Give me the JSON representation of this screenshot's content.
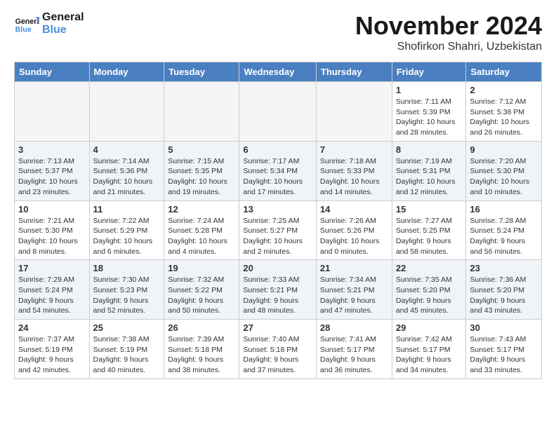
{
  "header": {
    "logo_line1": "General",
    "logo_line2": "Blue",
    "month": "November 2024",
    "location": "Shofirkon Shahri, Uzbekistan"
  },
  "days_of_week": [
    "Sunday",
    "Monday",
    "Tuesday",
    "Wednesday",
    "Thursday",
    "Friday",
    "Saturday"
  ],
  "weeks": [
    [
      {
        "day": "",
        "info": ""
      },
      {
        "day": "",
        "info": ""
      },
      {
        "day": "",
        "info": ""
      },
      {
        "day": "",
        "info": ""
      },
      {
        "day": "",
        "info": ""
      },
      {
        "day": "1",
        "info": "Sunrise: 7:11 AM\nSunset: 5:39 PM\nDaylight: 10 hours and 28 minutes."
      },
      {
        "day": "2",
        "info": "Sunrise: 7:12 AM\nSunset: 5:38 PM\nDaylight: 10 hours and 26 minutes."
      }
    ],
    [
      {
        "day": "3",
        "info": "Sunrise: 7:13 AM\nSunset: 5:37 PM\nDaylight: 10 hours and 23 minutes."
      },
      {
        "day": "4",
        "info": "Sunrise: 7:14 AM\nSunset: 5:36 PM\nDaylight: 10 hours and 21 minutes."
      },
      {
        "day": "5",
        "info": "Sunrise: 7:15 AM\nSunset: 5:35 PM\nDaylight: 10 hours and 19 minutes."
      },
      {
        "day": "6",
        "info": "Sunrise: 7:17 AM\nSunset: 5:34 PM\nDaylight: 10 hours and 17 minutes."
      },
      {
        "day": "7",
        "info": "Sunrise: 7:18 AM\nSunset: 5:33 PM\nDaylight: 10 hours and 14 minutes."
      },
      {
        "day": "8",
        "info": "Sunrise: 7:19 AM\nSunset: 5:31 PM\nDaylight: 10 hours and 12 minutes."
      },
      {
        "day": "9",
        "info": "Sunrise: 7:20 AM\nSunset: 5:30 PM\nDaylight: 10 hours and 10 minutes."
      }
    ],
    [
      {
        "day": "10",
        "info": "Sunrise: 7:21 AM\nSunset: 5:30 PM\nDaylight: 10 hours and 8 minutes."
      },
      {
        "day": "11",
        "info": "Sunrise: 7:22 AM\nSunset: 5:29 PM\nDaylight: 10 hours and 6 minutes."
      },
      {
        "day": "12",
        "info": "Sunrise: 7:24 AM\nSunset: 5:28 PM\nDaylight: 10 hours and 4 minutes."
      },
      {
        "day": "13",
        "info": "Sunrise: 7:25 AM\nSunset: 5:27 PM\nDaylight: 10 hours and 2 minutes."
      },
      {
        "day": "14",
        "info": "Sunrise: 7:26 AM\nSunset: 5:26 PM\nDaylight: 10 hours and 0 minutes."
      },
      {
        "day": "15",
        "info": "Sunrise: 7:27 AM\nSunset: 5:25 PM\nDaylight: 9 hours and 58 minutes."
      },
      {
        "day": "16",
        "info": "Sunrise: 7:28 AM\nSunset: 5:24 PM\nDaylight: 9 hours and 56 minutes."
      }
    ],
    [
      {
        "day": "17",
        "info": "Sunrise: 7:29 AM\nSunset: 5:24 PM\nDaylight: 9 hours and 54 minutes."
      },
      {
        "day": "18",
        "info": "Sunrise: 7:30 AM\nSunset: 5:23 PM\nDaylight: 9 hours and 52 minutes."
      },
      {
        "day": "19",
        "info": "Sunrise: 7:32 AM\nSunset: 5:22 PM\nDaylight: 9 hours and 50 minutes."
      },
      {
        "day": "20",
        "info": "Sunrise: 7:33 AM\nSunset: 5:21 PM\nDaylight: 9 hours and 48 minutes."
      },
      {
        "day": "21",
        "info": "Sunrise: 7:34 AM\nSunset: 5:21 PM\nDaylight: 9 hours and 47 minutes."
      },
      {
        "day": "22",
        "info": "Sunrise: 7:35 AM\nSunset: 5:20 PM\nDaylight: 9 hours and 45 minutes."
      },
      {
        "day": "23",
        "info": "Sunrise: 7:36 AM\nSunset: 5:20 PM\nDaylight: 9 hours and 43 minutes."
      }
    ],
    [
      {
        "day": "24",
        "info": "Sunrise: 7:37 AM\nSunset: 5:19 PM\nDaylight: 9 hours and 42 minutes."
      },
      {
        "day": "25",
        "info": "Sunrise: 7:38 AM\nSunset: 5:19 PM\nDaylight: 9 hours and 40 minutes."
      },
      {
        "day": "26",
        "info": "Sunrise: 7:39 AM\nSunset: 5:18 PM\nDaylight: 9 hours and 38 minutes."
      },
      {
        "day": "27",
        "info": "Sunrise: 7:40 AM\nSunset: 5:18 PM\nDaylight: 9 hours and 37 minutes."
      },
      {
        "day": "28",
        "info": "Sunrise: 7:41 AM\nSunset: 5:17 PM\nDaylight: 9 hours and 36 minutes."
      },
      {
        "day": "29",
        "info": "Sunrise: 7:42 AM\nSunset: 5:17 PM\nDaylight: 9 hours and 34 minutes."
      },
      {
        "day": "30",
        "info": "Sunrise: 7:43 AM\nSunset: 5:17 PM\nDaylight: 9 hours and 33 minutes."
      }
    ]
  ]
}
